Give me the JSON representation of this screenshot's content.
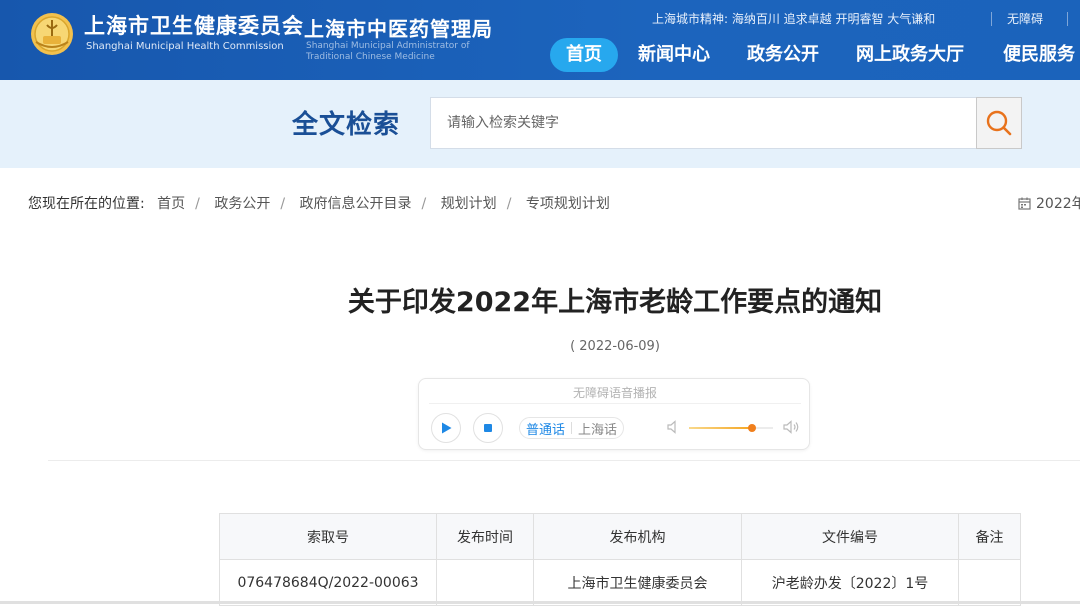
{
  "header": {
    "logo_icon": "shanghai-health-emblem-icon",
    "org1_cn": "上海市卫生健康委员会",
    "org1_en": "Shanghai Municipal Health Commission",
    "org2_cn": "上海市中医药管理局",
    "org2_en": "Shanghai Municipal Administrator of Traditional Chinese Medicine",
    "spirit_text": "上海城市精神: 海纳百川 追求卓越 开明睿智 大气谦和",
    "accessibility_link": "无障碍",
    "nav": [
      {
        "label": "首页",
        "active": true
      },
      {
        "label": "新闻中心",
        "active": false
      },
      {
        "label": "政务公开",
        "active": false
      },
      {
        "label": "网上政务大厅",
        "active": false
      },
      {
        "label": "便民服务",
        "active": false
      }
    ]
  },
  "search": {
    "title": "全文检索",
    "placeholder": "请输入检索关键字",
    "button_icon": "search-icon"
  },
  "breadcrumb": {
    "lead": "您现在所在的位置:",
    "items": [
      "首页",
      "政务公开",
      "政府信息公开目录",
      "规划计划",
      "专项规划计划"
    ],
    "date_partial": "2022年",
    "date_icon": "calendar-icon"
  },
  "article": {
    "title": "关于印发2022年上海市老龄工作要点的通知",
    "date": "( 2022-06-09)"
  },
  "player": {
    "label": "无障碍语音播报",
    "play_icon": "play-icon",
    "stop_icon": "stop-icon",
    "languages": [
      {
        "label": "普通话",
        "active": true
      },
      {
        "label": "上海话",
        "active": false
      }
    ],
    "volume": 0.75,
    "volume_low_icon": "volume-low-icon",
    "volume_high_icon": "volume-high-icon"
  },
  "info_table": {
    "headers": [
      "索取号",
      "发布时间",
      "发布机构",
      "文件编号",
      "备注"
    ],
    "rows": [
      [
        "076478684Q/2022-00063",
        "",
        "上海市卫生健康委员会",
        "沪老龄办发〔2022〕1号",
        ""
      ]
    ]
  },
  "colors": {
    "header_blue": "#1a5fb4",
    "nav_active": "#27a8ee",
    "search_band": "#e5f1fb",
    "search_title": "#1a4f96",
    "search_icon": "#e8721c",
    "lang_active": "#1e88e5",
    "volume_knob": "#f07f1c"
  }
}
